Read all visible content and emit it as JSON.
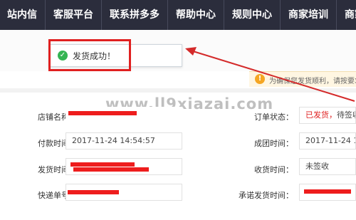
{
  "nav": {
    "items": [
      "站内信",
      "客服平台",
      "联系拼多多",
      "帮助中心",
      "规则中心",
      "商家培训",
      "商家"
    ]
  },
  "toast": {
    "message": "发货成功！"
  },
  "notice": {
    "text": "为确保您发货顺利，请按要求..."
  },
  "watermark": "www.ll9xiazai.com",
  "order": {
    "store_name_label": "店铺名称：",
    "pay_time_label": "付款时间：",
    "pay_time_value": "2017-11-24 14:54:57",
    "ship_time_label": "发货时间：",
    "tracking_label": "快递单号：",
    "status_label": "订单状态：",
    "status_value_red": "已发货，",
    "status_value_plain": "待签收",
    "group_time_label": "成团时间：",
    "group_time_value": "2017-11-24 14:5",
    "receive_time_label": "收货时间：",
    "receive_time_value": "未签收",
    "promise_time_label": "承诺发货时间："
  },
  "colors": {
    "nav_bg": "#2b2d3c",
    "highlight_red": "#e02020",
    "success_green": "#35b453",
    "warning_orange": "#f5a623",
    "redaction": "#ee1d1d"
  }
}
